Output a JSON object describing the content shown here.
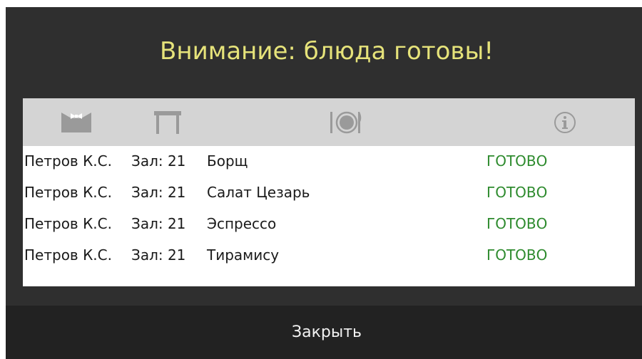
{
  "dialog": {
    "title": "Внимание: блюда готовы!",
    "close_label": "Закрыть"
  },
  "table": {
    "columns": [
      {
        "icon": "waiter-bowtie-icon"
      },
      {
        "icon": "table-icon"
      },
      {
        "icon": "dish-plate-icon"
      },
      {
        "icon": "info-icon"
      }
    ],
    "rows": [
      {
        "waiter": "Петров К.С.",
        "hall": "Зал: 21",
        "dish": "Борщ",
        "status": "ГОТОВО"
      },
      {
        "waiter": "Петров К.С.",
        "hall": "Зал: 21",
        "dish": "Салат Цезарь",
        "status": "ГОТОВО"
      },
      {
        "waiter": "Петров К.С.",
        "hall": "Зал: 21",
        "dish": "Эспрессо",
        "status": "ГОТОВО"
      },
      {
        "waiter": "Петров К.С.",
        "hall": "Зал: 21",
        "dish": "Тирамису",
        "status": "ГОТОВО"
      }
    ]
  },
  "colors": {
    "title": "#e6e37a",
    "status_ready": "#2e8b2e",
    "dialog_bg": "#2f2f2f",
    "footer_bg": "#222222",
    "header_bg": "#d4d4d4",
    "icon": "#9a9a9a"
  }
}
